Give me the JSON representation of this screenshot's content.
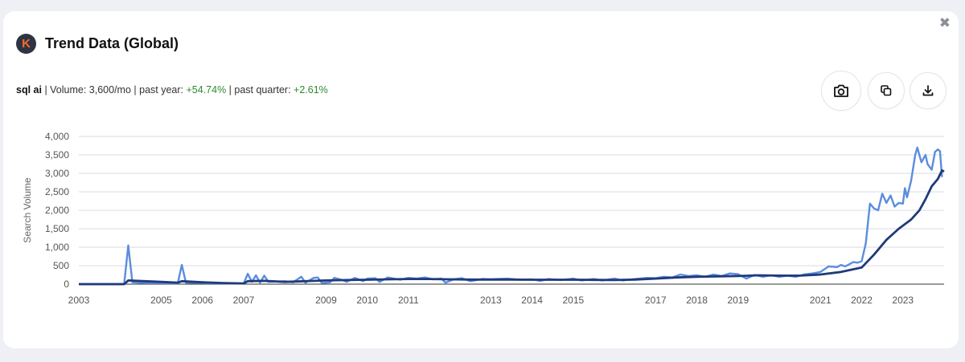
{
  "dialog": {
    "title": "Trend Data (Global)",
    "logo_letter": "K",
    "close_glyph": "✖"
  },
  "stats": {
    "keyword": "sql ai",
    "volume_text": " | Volume: 3,600/mo | past year: ",
    "past_year": "+54.74%",
    "quarter_text": " | past quarter: ",
    "past_quarter": "+2.61%"
  },
  "toolbar": {
    "screenshot_icon": "camera-icon",
    "copy_icon": "copy-icon",
    "download_icon": "download-icon"
  },
  "colors": {
    "volume_line": "#5b8dde",
    "trend_line": "#1f3a7a",
    "positive": "#2e8b2e"
  },
  "chart_data": {
    "type": "line",
    "xlabel": "",
    "ylabel": "Search Volume",
    "ylim": [
      0,
      4000
    ],
    "yticks": [
      0,
      500,
      1000,
      1500,
      2000,
      2500,
      3000,
      3500,
      4000
    ],
    "ytick_labels": [
      "0",
      "500",
      "1,000",
      "1,500",
      "2,000",
      "2,500",
      "3,000",
      "3,500",
      "4,000"
    ],
    "xlim": [
      2003.0,
      2023.7
    ],
    "xticks": [
      "2003",
      "2005",
      "2006",
      "2007",
      "2009",
      "2010",
      "2011",
      "2013",
      "2014",
      "2015",
      "2017",
      "2018",
      "2019",
      "2021",
      "2022",
      "2023"
    ],
    "grid": true,
    "series": [
      {
        "values": [
          [
            2003.0,
            0
          ],
          [
            2004.1,
            0
          ],
          [
            2004.2,
            1050
          ],
          [
            2004.3,
            50
          ],
          [
            2004.6,
            30
          ],
          [
            2005.0,
            25
          ],
          [
            2005.4,
            20
          ],
          [
            2005.5,
            520
          ],
          [
            2005.6,
            40
          ],
          [
            2006.0,
            30
          ],
          [
            2006.5,
            20
          ],
          [
            2007.0,
            15
          ],
          [
            2007.1,
            280
          ],
          [
            2007.2,
            60
          ],
          [
            2007.3,
            240
          ],
          [
            2007.4,
            40
          ],
          [
            2007.5,
            230
          ],
          [
            2007.6,
            60
          ],
          [
            2008.0,
            80
          ],
          [
            2008.2,
            50
          ],
          [
            2008.4,
            200
          ],
          [
            2008.5,
            40
          ],
          [
            2008.7,
            170
          ],
          [
            2008.8,
            180
          ],
          [
            2008.9,
            30
          ],
          [
            2009.1,
            50
          ],
          [
            2009.2,
            170
          ],
          [
            2009.4,
            110
          ],
          [
            2009.5,
            60
          ],
          [
            2009.7,
            170
          ],
          [
            2009.9,
            80
          ],
          [
            2010.0,
            150
          ],
          [
            2010.2,
            160
          ],
          [
            2010.3,
            60
          ],
          [
            2010.5,
            180
          ],
          [
            2010.8,
            120
          ],
          [
            2011.0,
            170
          ],
          [
            2011.2,
            150
          ],
          [
            2011.4,
            180
          ],
          [
            2011.6,
            130
          ],
          [
            2011.8,
            150
          ],
          [
            2011.9,
            40
          ],
          [
            2012.1,
            130
          ],
          [
            2012.3,
            160
          ],
          [
            2012.5,
            80
          ],
          [
            2012.8,
            140
          ],
          [
            2013.0,
            130
          ],
          [
            2013.4,
            150
          ],
          [
            2013.7,
            120
          ],
          [
            2014.0,
            130
          ],
          [
            2014.2,
            90
          ],
          [
            2014.4,
            140
          ],
          [
            2014.7,
            110
          ],
          [
            2015.0,
            150
          ],
          [
            2015.2,
            100
          ],
          [
            2015.5,
            140
          ],
          [
            2015.7,
            100
          ],
          [
            2016.0,
            150
          ],
          [
            2016.2,
            100
          ],
          [
            2016.5,
            140
          ],
          [
            2016.8,
            170
          ],
          [
            2017.0,
            160
          ],
          [
            2017.2,
            200
          ],
          [
            2017.4,
            180
          ],
          [
            2017.6,
            260
          ],
          [
            2017.8,
            220
          ],
          [
            2018.0,
            240
          ],
          [
            2018.2,
            200
          ],
          [
            2018.4,
            260
          ],
          [
            2018.6,
            220
          ],
          [
            2018.8,
            290
          ],
          [
            2019.0,
            270
          ],
          [
            2019.2,
            150
          ],
          [
            2019.4,
            250
          ],
          [
            2019.6,
            200
          ],
          [
            2019.8,
            240
          ],
          [
            2020.0,
            200
          ],
          [
            2020.2,
            230
          ],
          [
            2020.4,
            200
          ],
          [
            2020.6,
            260
          ],
          [
            2020.8,
            290
          ],
          [
            2021.0,
            330
          ],
          [
            2021.2,
            480
          ],
          [
            2021.4,
            460
          ],
          [
            2021.5,
            520
          ],
          [
            2021.6,
            480
          ],
          [
            2021.8,
            600
          ],
          [
            2021.9,
            580
          ],
          [
            2022.0,
            620
          ],
          [
            2022.1,
            1100
          ],
          [
            2022.2,
            2180
          ],
          [
            2022.3,
            2050
          ],
          [
            2022.4,
            2000
          ],
          [
            2022.5,
            2450
          ],
          [
            2022.6,
            2200
          ],
          [
            2022.7,
            2400
          ],
          [
            2022.8,
            2100
          ],
          [
            2022.9,
            2200
          ],
          [
            2023.0,
            2180
          ],
          [
            2023.05,
            2600
          ],
          [
            2023.1,
            2350
          ],
          [
            2023.2,
            2800
          ],
          [
            2023.3,
            3500
          ],
          [
            2023.35,
            3700
          ],
          [
            2023.45,
            3300
          ],
          [
            2023.55,
            3500
          ],
          [
            2023.6,
            3250
          ],
          [
            2023.7,
            3100
          ],
          [
            2023.78,
            3580
          ],
          [
            2023.85,
            3650
          ],
          [
            2023.9,
            3600
          ],
          [
            2023.95,
            2900
          ]
        ]
      },
      {
        "values": [
          [
            2003.0,
            0
          ],
          [
            2004.1,
            0
          ],
          [
            2004.2,
            100
          ],
          [
            2004.6,
            80
          ],
          [
            2005.0,
            60
          ],
          [
            2005.4,
            40
          ],
          [
            2005.5,
            80
          ],
          [
            2006.0,
            50
          ],
          [
            2006.5,
            30
          ],
          [
            2007.0,
            20
          ],
          [
            2007.1,
            80
          ],
          [
            2007.5,
            90
          ],
          [
            2008.0,
            60
          ],
          [
            2008.5,
            80
          ],
          [
            2009.0,
            100
          ],
          [
            2009.5,
            110
          ],
          [
            2010.0,
            120
          ],
          [
            2010.5,
            130
          ],
          [
            2011.0,
            140
          ],
          [
            2011.5,
            140
          ],
          [
            2012.0,
            130
          ],
          [
            2012.5,
            125
          ],
          [
            2013.0,
            125
          ],
          [
            2013.5,
            125
          ],
          [
            2014.0,
            120
          ],
          [
            2014.5,
            120
          ],
          [
            2015.0,
            120
          ],
          [
            2015.5,
            115
          ],
          [
            2016.0,
            110
          ],
          [
            2016.5,
            125
          ],
          [
            2017.0,
            150
          ],
          [
            2017.5,
            180
          ],
          [
            2018.0,
            200
          ],
          [
            2018.5,
            210
          ],
          [
            2019.0,
            220
          ],
          [
            2019.5,
            240
          ],
          [
            2020.0,
            230
          ],
          [
            2020.5,
            230
          ],
          [
            2021.0,
            260
          ],
          [
            2021.5,
            330
          ],
          [
            2022.0,
            450
          ],
          [
            2022.3,
            800
          ],
          [
            2022.6,
            1200
          ],
          [
            2022.9,
            1500
          ],
          [
            2023.2,
            1750
          ],
          [
            2023.4,
            2000
          ],
          [
            2023.55,
            2300
          ],
          [
            2023.7,
            2650
          ],
          [
            2023.85,
            2850
          ],
          [
            2023.95,
            3080
          ],
          [
            2024.0,
            3050
          ]
        ]
      }
    ]
  }
}
